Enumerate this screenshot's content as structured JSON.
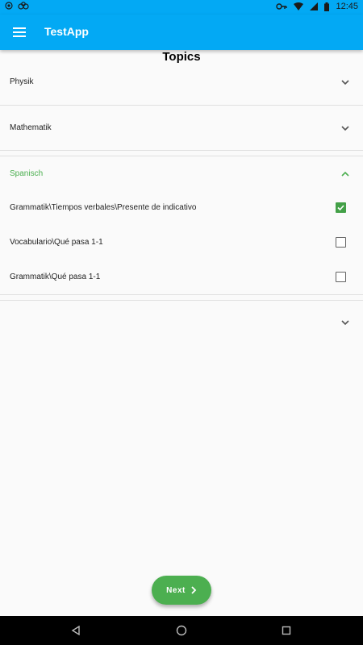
{
  "status_bar": {
    "time": "12:45",
    "icons": [
      "record-icon",
      "sync-icon",
      "key-icon",
      "wifi-icon",
      "signal-icon",
      "battery-icon"
    ]
  },
  "app_bar": {
    "title": "TestApp",
    "menu_icon": "hamburger-menu-icon",
    "color": "#03a9f4"
  },
  "page": {
    "title": "Topics"
  },
  "topics": [
    {
      "label": "Physik",
      "expanded": false
    },
    {
      "label": "Mathematik",
      "expanded": false
    },
    {
      "label": "Spanisch",
      "expanded": true,
      "accent": "#4caf50",
      "subtopics": [
        {
          "label": "Grammatik\\Tiempos verbales\\Presente de indicativo",
          "checked": true
        },
        {
          "label": "Vocabulario\\Qué pasa 1-1",
          "checked": false
        },
        {
          "label": "Grammatik\\Qué pasa 1-1",
          "checked": false
        }
      ]
    },
    {
      "label": "",
      "expanded": false
    }
  ],
  "next_button": {
    "label": "Next",
    "icon": "chevron-right-icon",
    "color": "#4caf50"
  },
  "nav_bar": {
    "buttons": [
      "back-icon",
      "home-icon",
      "recents-icon"
    ]
  }
}
